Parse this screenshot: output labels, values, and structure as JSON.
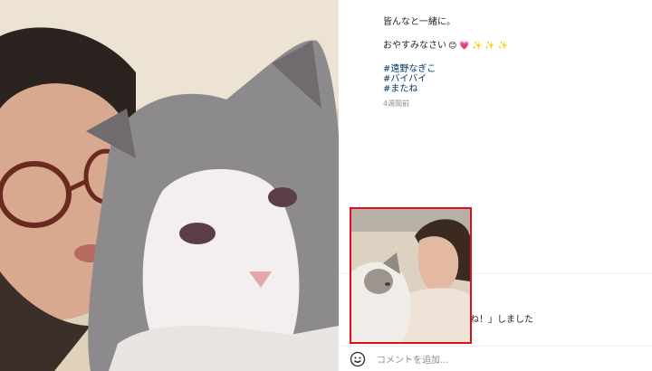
{
  "caption": {
    "line1": "皆んなと一緒に。",
    "line2": "おやすみなさい",
    "emojis": "😊 💗 ✨ ✨ ✨",
    "hashtags": [
      "#遠野なぎこ",
      "#バイバイ",
      "#またね"
    ],
    "timestamp": "4週間前"
  },
  "likes": {
    "text": "ね！」しました"
  },
  "comment": {
    "placeholder": "コメントを追加...",
    "emoji_icon": "smile-icon"
  },
  "colors": {
    "hashtag": "#00376b",
    "inset_border": "#e0101a",
    "muted": "#8e8e8e"
  }
}
